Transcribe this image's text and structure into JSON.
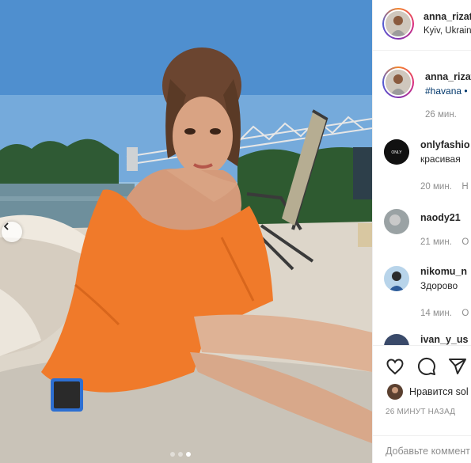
{
  "post": {
    "author": "anna_rizat",
    "location": "Kyiv, Ukrain",
    "caption_tag": "#havana •",
    "caption_time": "26 мин.",
    "likes_text": "Нравится sol",
    "post_date": "26 МИНУТ НАЗАД",
    "comment_placeholder": "Добавьте коммент",
    "carousel": {
      "count": 3,
      "active_index": 2
    }
  },
  "comments": [
    {
      "user": "onlyfashio",
      "text": "красивая",
      "time": "20 мин.",
      "reply": "Н"
    },
    {
      "user": "naody21",
      "text": "",
      "time": "21 мин.",
      "reply": "О"
    },
    {
      "user": "nikomu_n",
      "text": "Здорово",
      "time": "14 мин.",
      "reply": "О"
    },
    {
      "user": "ivan_y_us",
      "text": "",
      "time": "",
      "reply": ""
    }
  ],
  "icons": [
    "chevron-left-icon",
    "heart-icon",
    "comment-icon",
    "share-icon"
  ],
  "colors": {
    "dress": "#f07a2a",
    "link": "#00376b",
    "muted": "#8e8e8e"
  }
}
